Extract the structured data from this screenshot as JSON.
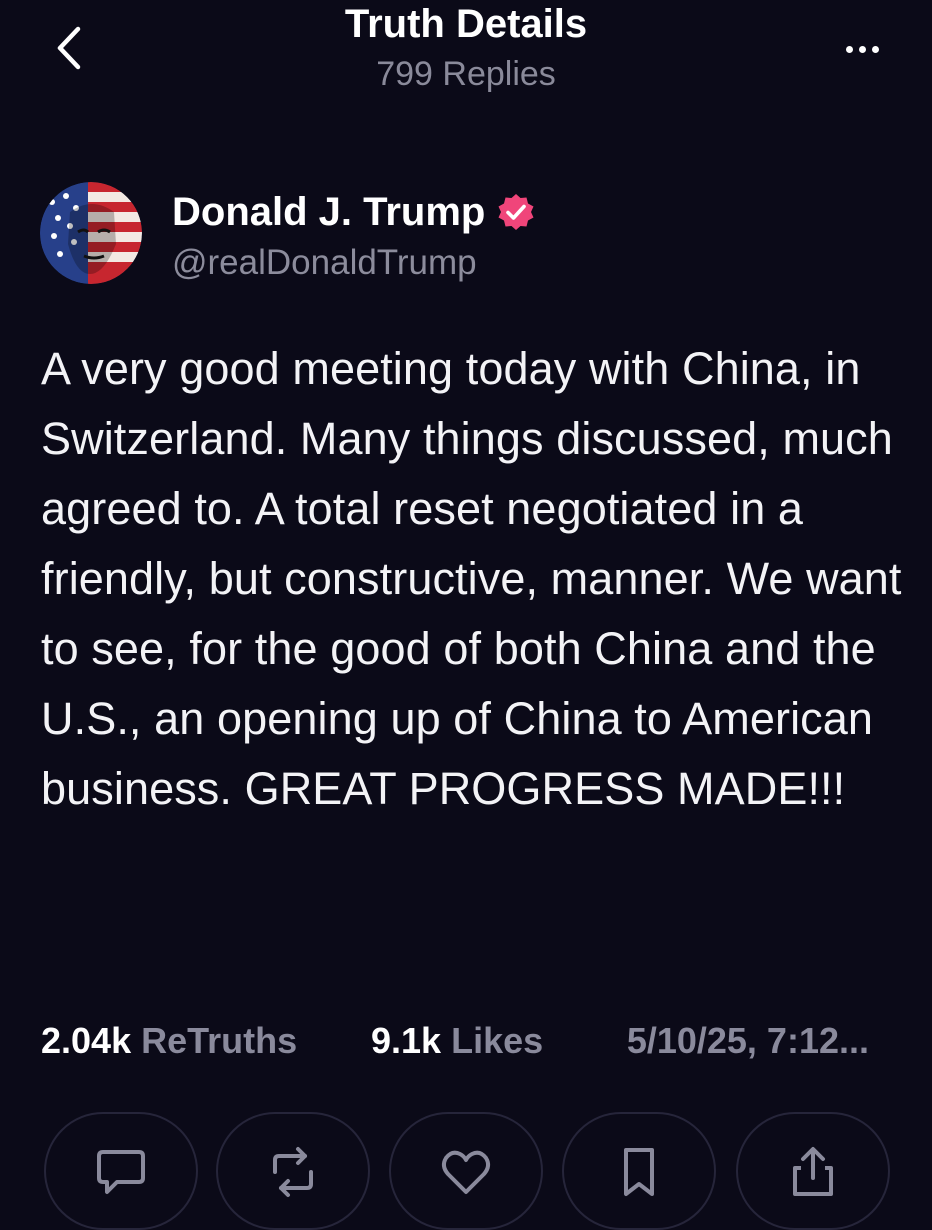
{
  "header": {
    "title": "Truth Details",
    "subtitle": "799 Replies",
    "back_icon": "chevron-left-icon",
    "more_icon": "more-horizontal-icon"
  },
  "author": {
    "name": "Donald J. Trump",
    "handle": "@realDonaldTrump",
    "verified_color": "#f0457a"
  },
  "post": {
    "text": "A very good meeting today with China, in Switzerland. Many things discussed, much agreed to. A total reset negotiated in a friendly, but constructive, manner. We want to see, for the good of both China and the U.S., an opening up of China to American business. GREAT PROGRESS MADE!!!"
  },
  "stats": {
    "retruths_count": "2.04k",
    "retruths_label": "ReTruths",
    "likes_count": "9.1k",
    "likes_label": "Likes",
    "timestamp": "5/10/25, 7:12..."
  },
  "actions": [
    {
      "icon": "reply-icon"
    },
    {
      "icon": "retruth-icon"
    },
    {
      "icon": "like-heart-icon"
    },
    {
      "icon": "bookmark-icon"
    },
    {
      "icon": "share-icon"
    }
  ],
  "colors": {
    "background": "#0b0a18",
    "muted_text": "#8a8a9c",
    "accent": "#f0457a"
  }
}
